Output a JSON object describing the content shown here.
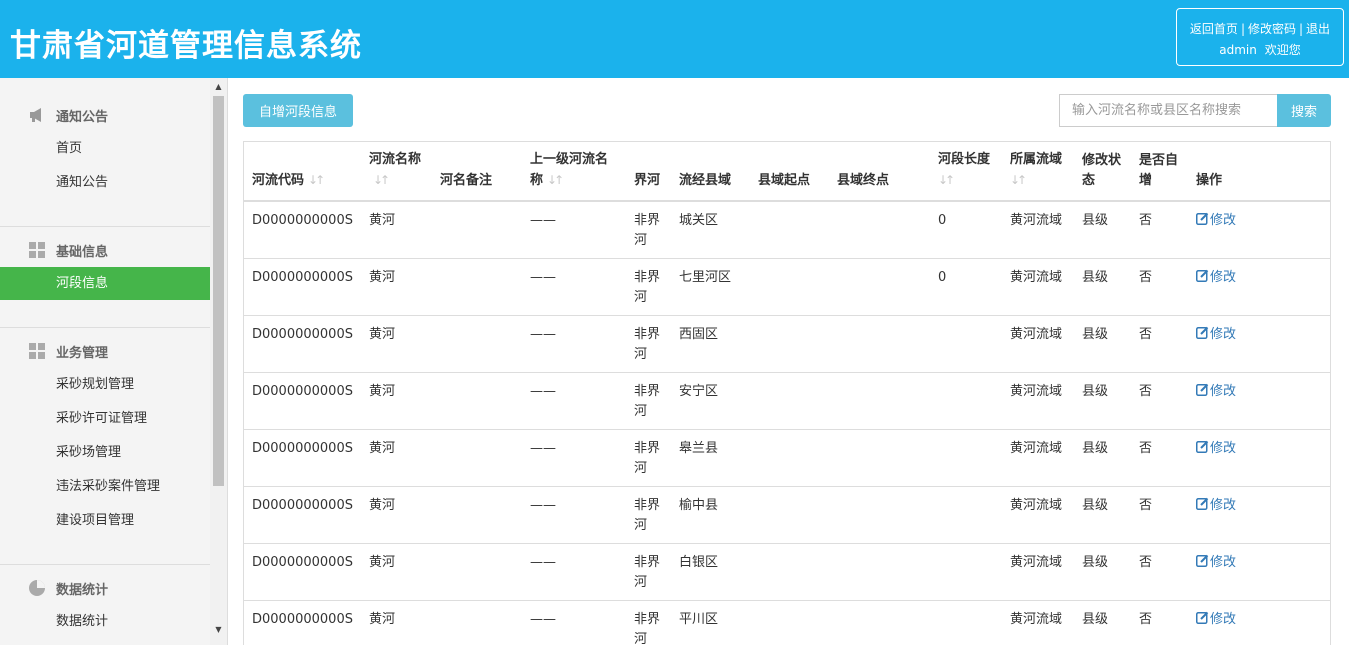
{
  "header": {
    "title": "甘肃省河道管理信息系统",
    "links": [
      "返回首页",
      "修改密码",
      "退出"
    ],
    "separator": "|",
    "username": "admin",
    "welcome": "欢迎您",
    "bg_color": "#1bb2ec"
  },
  "sidebar": {
    "sections": [
      {
        "heading": "通知公告",
        "icon": "megaphone-icon",
        "items": [
          "首页",
          "通知公告"
        ]
      },
      {
        "heading": "基础信息",
        "icon": "grid-icon",
        "items": [
          "河段信息"
        ]
      },
      {
        "heading": "业务管理",
        "icon": "grid-icon",
        "items": [
          "采砂规划管理",
          "采砂许可证管理",
          "采砂场管理",
          "违法采砂案件管理",
          "建设项目管理"
        ]
      },
      {
        "heading": "数据统计",
        "icon": "pie-chart-icon",
        "items": [
          "数据统计"
        ]
      }
    ],
    "active_item": "河段信息",
    "active_color": "#45b54a"
  },
  "toolbar": {
    "add_label": "自增河段信息",
    "search_placeholder": "输入河流名称或县区名称搜索",
    "search_label": "搜索",
    "accent_color": "#5bc0de"
  },
  "table": {
    "columns": [
      "河流代码",
      "河流名称",
      "河名备注",
      "上一级河流名称",
      "界河",
      "流经县域",
      "县域起点",
      "县域终点",
      "河段长度",
      "所属流域",
      "修改状态",
      "是否自增",
      "操作"
    ],
    "edit_label": "修改",
    "rows": [
      [
        "D0000000000S",
        "黄河",
        "",
        "——",
        "非界河",
        "城关区",
        "",
        "",
        "0",
        "黄河流域",
        "县级",
        "否"
      ],
      [
        "D0000000000S",
        "黄河",
        "",
        "——",
        "非界河",
        "七里河区",
        "",
        "",
        "0",
        "黄河流域",
        "县级",
        "否"
      ],
      [
        "D0000000000S",
        "黄河",
        "",
        "——",
        "非界河",
        "西固区",
        "",
        "",
        "",
        "黄河流域",
        "县级",
        "否"
      ],
      [
        "D0000000000S",
        "黄河",
        "",
        "——",
        "非界河",
        "安宁区",
        "",
        "",
        "",
        "黄河流域",
        "县级",
        "否"
      ],
      [
        "D0000000000S",
        "黄河",
        "",
        "——",
        "非界河",
        "皋兰县",
        "",
        "",
        "",
        "黄河流域",
        "县级",
        "否"
      ],
      [
        "D0000000000S",
        "黄河",
        "",
        "——",
        "非界河",
        "榆中县",
        "",
        "",
        "",
        "黄河流域",
        "县级",
        "否"
      ],
      [
        "D0000000000S",
        "黄河",
        "",
        "——",
        "非界河",
        "白银区",
        "",
        "",
        "",
        "黄河流域",
        "县级",
        "否"
      ],
      [
        "D0000000000S",
        "黄河",
        "",
        "——",
        "非界河",
        "平川区",
        "",
        "",
        "",
        "黄河流域",
        "县级",
        "否"
      ]
    ]
  }
}
